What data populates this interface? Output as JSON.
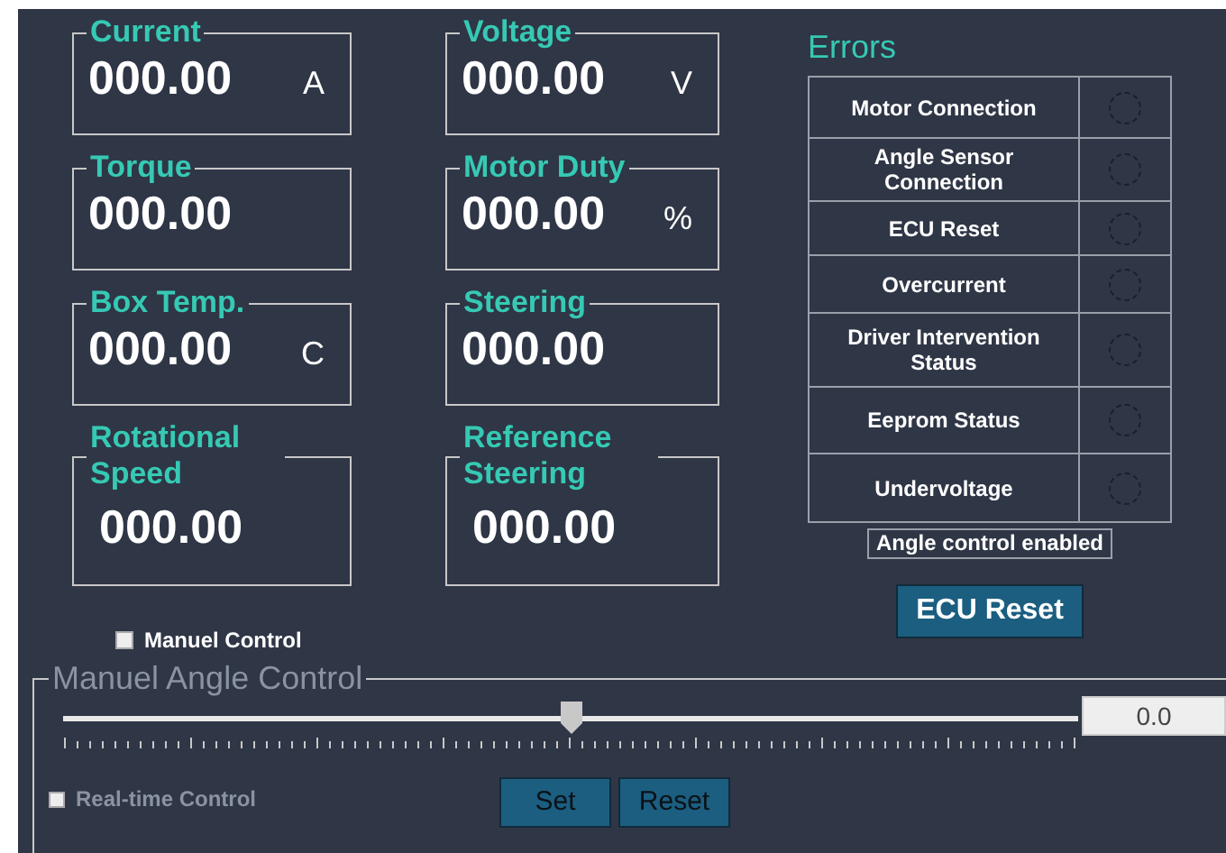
{
  "readings": [
    {
      "label": "Current",
      "value": "000.00",
      "unit": "A"
    },
    {
      "label": "Voltage",
      "value": "000.00",
      "unit": "V"
    },
    {
      "label": "Torque",
      "value": "000.00"
    },
    {
      "label": "Motor Duty",
      "value": "000.00",
      "unit": "%"
    },
    {
      "label": "Box Temp.",
      "value": "000.00",
      "unit": "C"
    },
    {
      "label": "Steering",
      "value": "000.00"
    },
    {
      "label": "Rotational Speed",
      "value": "000.00"
    },
    {
      "label": "Reference Steering",
      "value": "000.00"
    }
  ],
  "errors": {
    "title": "Errors",
    "items": [
      {
        "label": "Motor Connection",
        "on": false
      },
      {
        "label": "Angle Sensor Connection",
        "on": false
      },
      {
        "label": "ECU Reset",
        "on": false
      },
      {
        "label": "Overcurrent",
        "on": false
      },
      {
        "label": "Driver Intervention Status",
        "on": false
      },
      {
        "label": "Eeprom Status",
        "on": false
      },
      {
        "label": "Undervoltage",
        "on": false
      }
    ],
    "status": "Angle control enabled",
    "reset_button": "ECU Reset"
  },
  "manual_control": {
    "label": "Manuel Control",
    "checked": false
  },
  "angle_control": {
    "title": "Manuel Angle Control",
    "disabled": true,
    "slider": {
      "level": 0.5
    },
    "value": "0.0",
    "realtime": {
      "label": "Real-time Control",
      "checked": false
    },
    "buttons": [
      "Set",
      "Reset"
    ]
  }
}
